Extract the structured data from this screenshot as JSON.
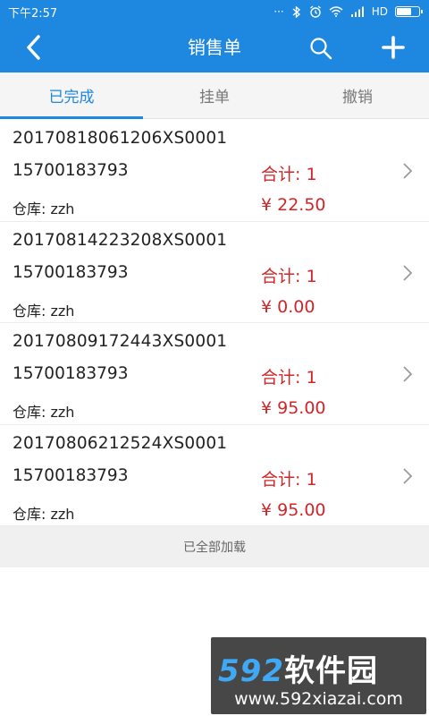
{
  "status_bar": {
    "time": "下午2:57",
    "dots": "···",
    "network": "HD"
  },
  "header": {
    "title": "销售单"
  },
  "tabs": [
    {
      "label": "已完成",
      "active": true
    },
    {
      "label": "挂单",
      "active": false
    },
    {
      "label": "撤销",
      "active": false
    }
  ],
  "orders": [
    {
      "order_no": "20170818061206XS0001",
      "phone": "15700183793",
      "total": "合计: 1",
      "warehouse": "仓库: zzh",
      "amount": "¥ 22.50"
    },
    {
      "order_no": "20170814223208XS0001",
      "phone": "15700183793",
      "total": "合计: 1",
      "warehouse": "仓库: zzh",
      "amount": "¥ 0.00"
    },
    {
      "order_no": "20170809172443XS0001",
      "phone": "15700183793",
      "total": "合计: 1",
      "warehouse": "仓库: zzh",
      "amount": "¥ 95.00"
    },
    {
      "order_no": "20170806212524XS0001",
      "phone": "15700183793",
      "total": "合计: 1",
      "warehouse": "仓库: zzh",
      "amount": "¥ 95.00"
    }
  ],
  "footer_note": "已全部加载",
  "watermark": {
    "brand_num": "592",
    "brand_text": "软件园",
    "url": "www.592xiazai.com"
  },
  "colors": {
    "primary": "#1e87e0",
    "amount_red": "#d0262a"
  }
}
